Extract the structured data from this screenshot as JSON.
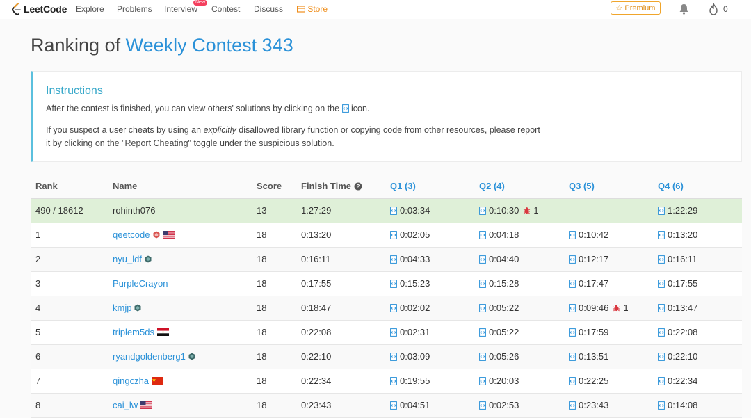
{
  "nav": {
    "logo_text": "LeetCode",
    "items": [
      "Explore",
      "Problems",
      "Interview",
      "Contest",
      "Discuss"
    ],
    "new_badge": "New",
    "store": "Store",
    "premium": "Premium",
    "fire_count": "0"
  },
  "page": {
    "title_prefix": "Ranking of ",
    "contest_name": "Weekly Contest 343"
  },
  "instructions": {
    "title": "Instructions",
    "p1_before": "After the contest is finished, you can view others' solutions by clicking on the ",
    "p1_after": " icon.",
    "p2_before": "If you suspect a user cheats by using an ",
    "p2_em": "explicitly",
    "p2_after": " disallowed library function or copying code from other resources, please report it by clicking on the \"Report Cheating\" toggle under the suspicious solution."
  },
  "table": {
    "headers": {
      "rank": "Rank",
      "name": "Name",
      "score": "Score",
      "finish_time": "Finish Time",
      "q1": "Q1 (3)",
      "q2": "Q2 (4)",
      "q3": "Q3 (5)",
      "q4": "Q4 (6)"
    },
    "my_row": {
      "rank": "490 / 18612",
      "name": "rohinth076",
      "score": "13",
      "finish_time": "1:27:29",
      "q1": "0:03:34",
      "q2": "0:10:30",
      "q2_bug": "1",
      "q3": "",
      "q4": "1:22:29"
    },
    "rows": [
      {
        "rank": "1",
        "name": "qeetcode",
        "score": "18",
        "finish_time": "0:13:20",
        "q1": "0:02:05",
        "q2": "0:04:18",
        "q3": "0:10:42",
        "q4": "0:13:20",
        "flag": "us",
        "badge": "guardian"
      },
      {
        "rank": "2",
        "name": "nyu_ldf",
        "score": "18",
        "finish_time": "0:16:11",
        "q1": "0:04:33",
        "q2": "0:04:40",
        "q3": "0:12:17",
        "q4": "0:16:11",
        "badge": "knight"
      },
      {
        "rank": "3",
        "name": "PurpleCrayon",
        "score": "18",
        "finish_time": "0:17:55",
        "q1": "0:15:23",
        "q2": "0:15:28",
        "q3": "0:17:47",
        "q4": "0:17:55"
      },
      {
        "rank": "4",
        "name": "kmjp",
        "score": "18",
        "finish_time": "0:18:47",
        "q1": "0:02:02",
        "q2": "0:05:22",
        "q3": "0:09:46",
        "q3_bug": "1",
        "q4": "0:13:47",
        "badge": "knight"
      },
      {
        "rank": "5",
        "name": "triplem5ds",
        "score": "18",
        "finish_time": "0:22:08",
        "q1": "0:02:31",
        "q2": "0:05:22",
        "q3": "0:17:59",
        "q4": "0:22:08",
        "flag": "eg"
      },
      {
        "rank": "6",
        "name": "ryandgoldenberg1",
        "score": "18",
        "finish_time": "0:22:10",
        "q1": "0:03:09",
        "q2": "0:05:26",
        "q3": "0:13:51",
        "q4": "0:22:10",
        "badge": "knight"
      },
      {
        "rank": "7",
        "name": "qingczha",
        "score": "18",
        "finish_time": "0:22:34",
        "q1": "0:19:55",
        "q2": "0:20:03",
        "q3": "0:22:25",
        "q4": "0:22:34",
        "flag": "cn"
      },
      {
        "rank": "8",
        "name": "cai_lw",
        "score": "18",
        "finish_time": "0:23:43",
        "q1": "0:04:51",
        "q2": "0:02:53",
        "q3": "0:23:43",
        "q4": "0:14:08",
        "flag": "us"
      }
    ]
  },
  "colors": {
    "accent": "#2a91d8",
    "store": "#ef8e1b",
    "instructions_border": "#5bc0de",
    "my_row_bg": "#dff0d8",
    "bug": "#d9363e"
  }
}
